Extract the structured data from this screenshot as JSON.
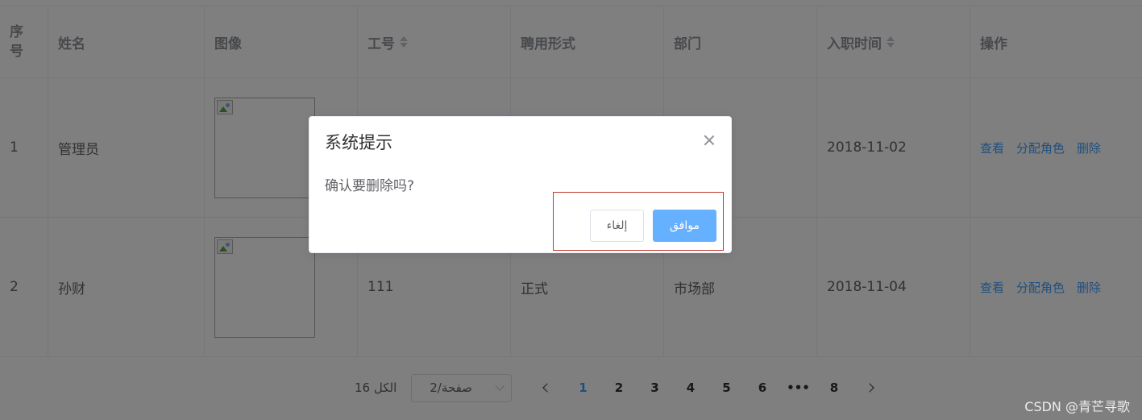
{
  "table": {
    "headers": {
      "index": "序号",
      "name": "姓名",
      "image": "图像",
      "work_no": "工号",
      "employment_type": "聘用形式",
      "department": "部门",
      "hire_date": "入职时间",
      "actions": "操作"
    },
    "rows": [
      {
        "index": "1",
        "name": "管理员",
        "work_no": "",
        "employment_type": "",
        "department": "",
        "hire_date": "2018-11-02",
        "actions": [
          "查看",
          "分配角色",
          "删除"
        ]
      },
      {
        "index": "2",
        "name": "孙财",
        "work_no": "111",
        "employment_type": "正式",
        "department": "市场部",
        "hire_date": "2018-11-04",
        "actions": [
          "查看",
          "分配角色",
          "删除"
        ]
      }
    ]
  },
  "pagination": {
    "total_label": "الكل 16",
    "page_size_label": "2/صفحة",
    "pages": [
      "1",
      "2",
      "3",
      "4",
      "5",
      "6",
      "•••",
      "8"
    ],
    "current_page": "1"
  },
  "dialog": {
    "title": "系统提示",
    "message": "确认要删除吗?",
    "cancel_label": "إلغاء",
    "confirm_label": "موافق"
  },
  "watermark": "CSDN @青芒寻歌",
  "colors": {
    "primary": "#409eff",
    "primary_light": "#66b1ff",
    "mask": "rgba(0,0,0,0.5)",
    "highlight_border": "#c0392b"
  }
}
